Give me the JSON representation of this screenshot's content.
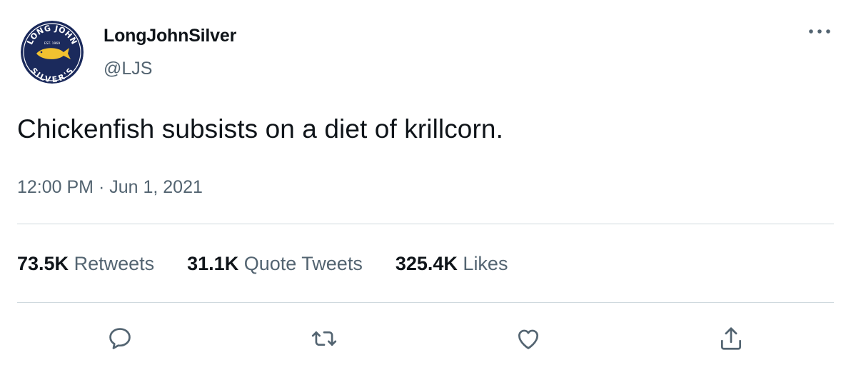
{
  "author": {
    "display_name": "LongJohnSilver",
    "handle": "@LJS",
    "avatar_text_top": "LONG JOHN",
    "avatar_text_bottom": "SILVER'S",
    "avatar_est": "EST. 1969"
  },
  "tweet": {
    "text": "Chickenfish subsists on a diet of krillcorn.",
    "timestamp": "12:00 PM · Jun 1, 2021"
  },
  "stats": {
    "retweets_count": "73.5K",
    "retweets_label": "Retweets",
    "quotes_count": "31.1K",
    "quotes_label": "Quote Tweets",
    "likes_count": "325.4K",
    "likes_label": "Likes"
  },
  "icons": {
    "more": "more-horizontal-icon",
    "reply": "reply-bubble-icon",
    "retweet": "retweet-icon",
    "like": "heart-icon",
    "share": "share-upload-icon"
  },
  "colors": {
    "text_primary": "#0f1419",
    "text_secondary": "#536471",
    "divider": "#cfd9de",
    "avatar_navy": "#1b2a5c",
    "avatar_fish": "#f2c230"
  }
}
